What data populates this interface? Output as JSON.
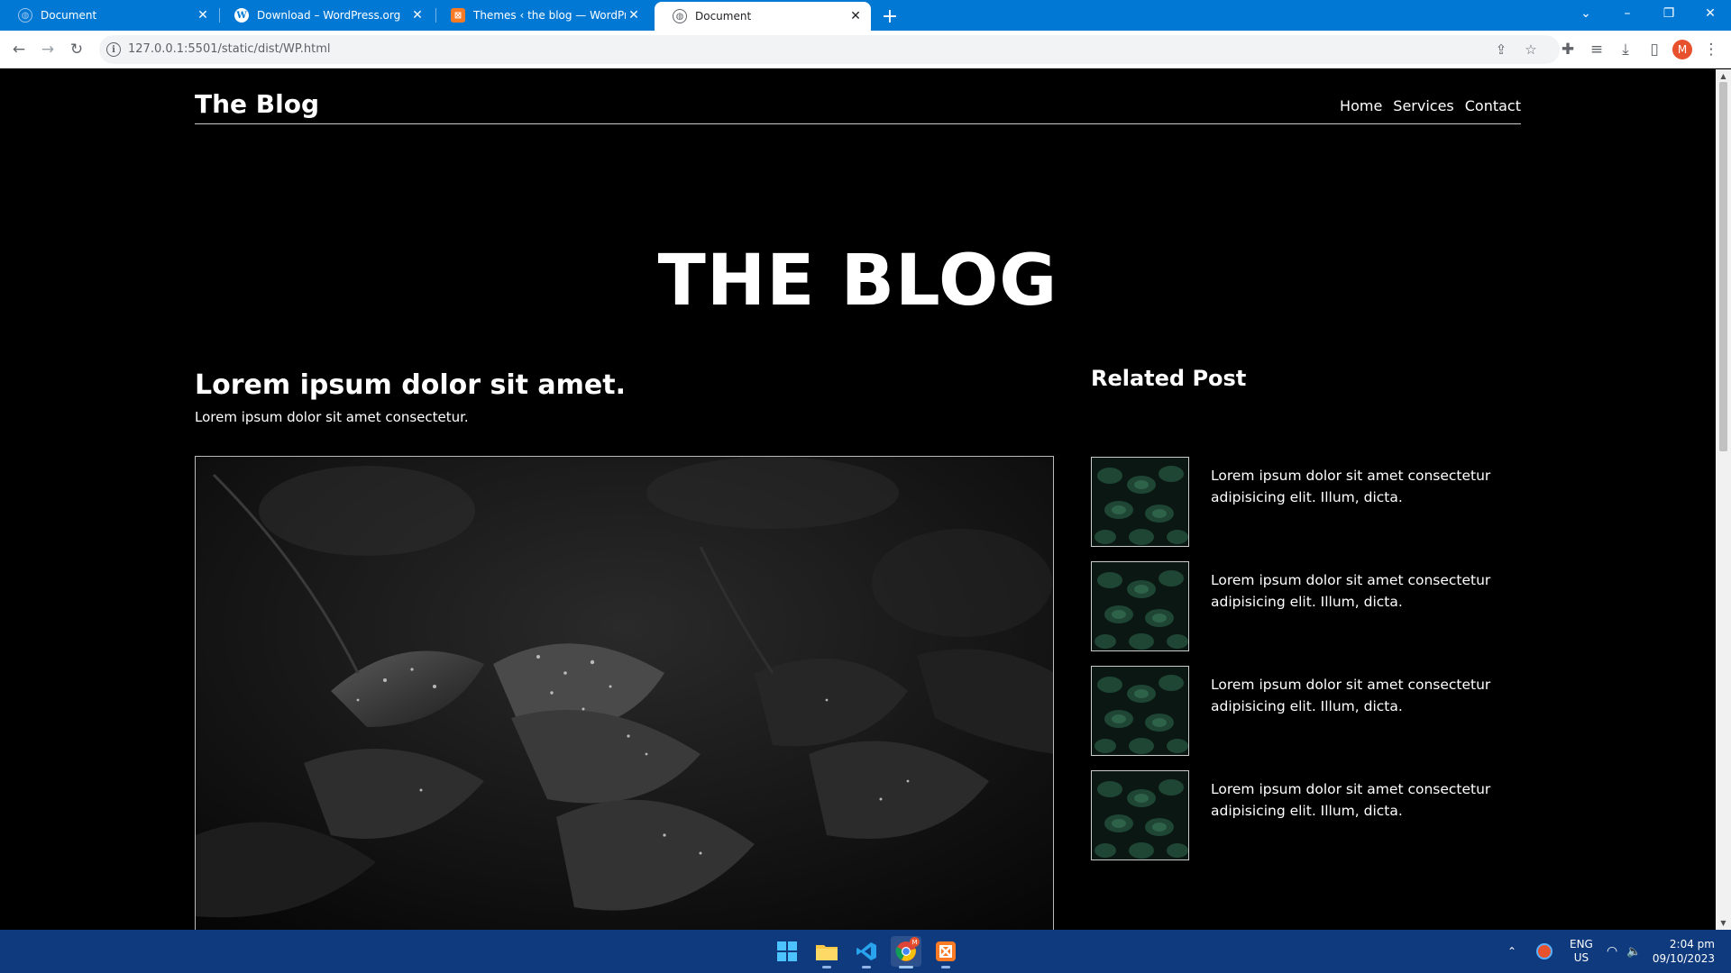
{
  "browser": {
    "tabs": [
      {
        "title": "Document",
        "icon": "globe-icon",
        "active": false
      },
      {
        "title": "Download – WordPress.org",
        "icon": "wordpress-icon",
        "active": false
      },
      {
        "title": "Themes ‹ the blog — WordPress",
        "icon": "xampp-icon",
        "active": false
      },
      {
        "title": "Document",
        "icon": "globe-icon",
        "active": true
      }
    ],
    "url": "127.0.0.1:5501/static/dist/WP.html",
    "profile_initial": "M"
  },
  "page": {
    "brand": "The Blog",
    "nav": [
      "Home",
      "Services",
      "Contact"
    ],
    "hero": "THE BLOG",
    "post": {
      "title": "Lorem ipsum dolor sit amet.",
      "subtitle": "Lorem ipsum dolor sit amet consectetur."
    },
    "related": {
      "title": "Related Post",
      "items": [
        {
          "text": "Lorem ipsum dolor sit amet consectetur adipisicing elit. Illum, dicta."
        },
        {
          "text": "Lorem ipsum dolor sit amet consectetur adipisicing elit. Illum, dicta."
        },
        {
          "text": "Lorem ipsum dolor sit amet consectetur adipisicing elit. Illum, dicta."
        },
        {
          "text": "Lorem ipsum dolor sit amet consectetur adipisicing elit. Illum, dicta."
        }
      ]
    }
  },
  "taskbar": {
    "lang_top": "ENG",
    "lang_bottom": "US",
    "time": "2:04 pm",
    "date": "09/10/2023",
    "chrome_badge": "M"
  },
  "colors": {
    "titlebar": "#0078d4",
    "page_bg": "#000000",
    "taskbar": "#0f3a7d"
  }
}
